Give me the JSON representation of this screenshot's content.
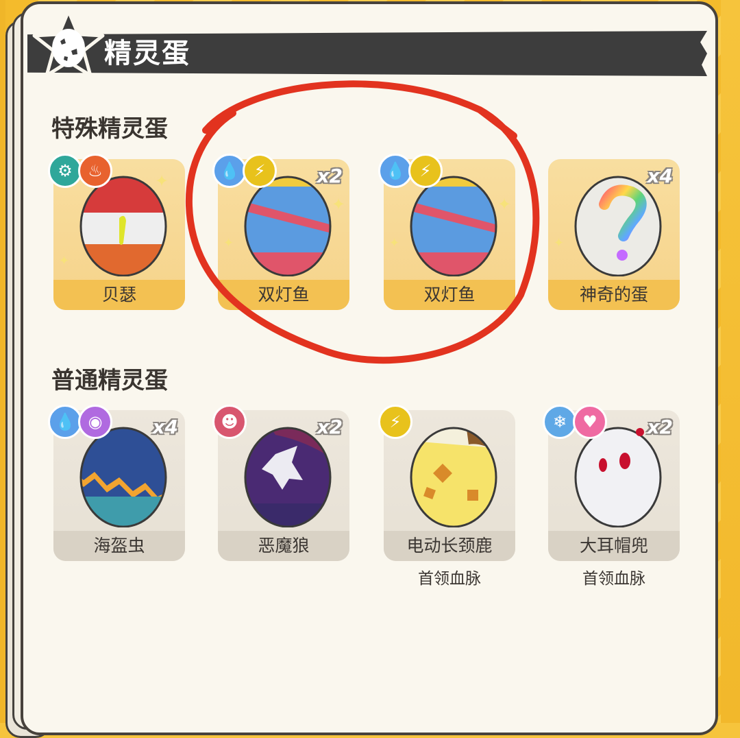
{
  "header": {
    "title": "精灵蛋"
  },
  "special": {
    "title": "特殊精灵蛋",
    "items": [
      {
        "name": "贝瑟",
        "count": "",
        "types": [
          "gear-type-icon",
          "fire-type-icon"
        ]
      },
      {
        "name": "双灯鱼",
        "count": "x2",
        "types": [
          "water-type-icon",
          "electric-type-icon"
        ]
      },
      {
        "name": "双灯鱼",
        "count": "",
        "types": [
          "water-type-icon",
          "electric-type-icon"
        ]
      },
      {
        "name": "神奇的蛋",
        "count": "x4",
        "types": []
      }
    ]
  },
  "normal": {
    "title": "普通精灵蛋",
    "items": [
      {
        "name": "海盔虫",
        "count": "x4",
        "sub": "",
        "types": [
          "water-type-icon",
          "bubble-type-icon"
        ]
      },
      {
        "name": "恶魔狼",
        "count": "x2",
        "sub": "",
        "types": [
          "demon-type-icon"
        ]
      },
      {
        "name": "电动长颈鹿",
        "count": "",
        "sub": "首领血脉",
        "types": [
          "electric-type-icon"
        ]
      },
      {
        "name": "大耳帽兜",
        "count": "x2",
        "sub": "首领血脉",
        "types": [
          "ice-type-icon",
          "heart-type-icon"
        ]
      }
    ]
  },
  "colors": {
    "accent": "#f3c152",
    "annotation": "#e2331f",
    "water": "#5ba0ea",
    "electric": "#e8c21c",
    "fire": "#e8622e",
    "gear": "#2fa79a",
    "bubble": "#b06ae0",
    "demon": "#d8566f",
    "ice": "#5fa8e6",
    "heart": "#ef6aa2"
  }
}
